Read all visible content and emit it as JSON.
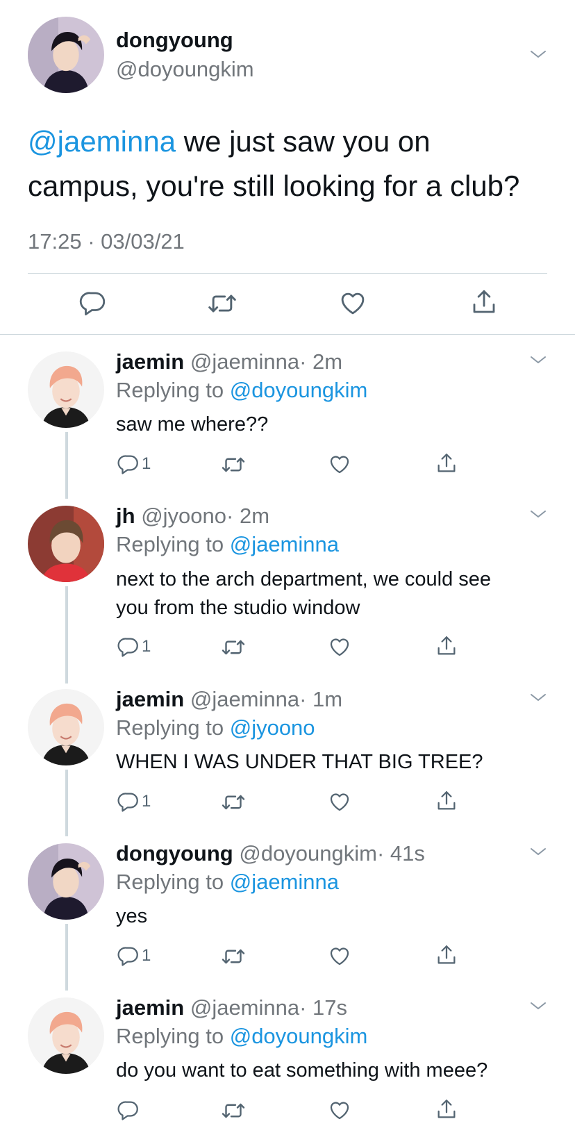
{
  "main_tweet": {
    "display_name": "dongyoung",
    "handle": "@doyoungkim",
    "mention": "@jaeminna",
    "text_line1": " we just saw you on",
    "text_line2": "campus, you're still looking for a club?",
    "timestamp": "17:25 · 03/03/21"
  },
  "replies": [
    {
      "display_name": "jaemin",
      "handle": "@jaeminna",
      "time": "· 2m",
      "replying_prefix": "Replying to ",
      "replying_to": "@doyoungkim",
      "text": "saw me where??",
      "reply_count": "1"
    },
    {
      "display_name": "jh",
      "handle": "@jyoono",
      "time": "· 2m",
      "replying_prefix": "Replying to ",
      "replying_to": "@jaeminna",
      "text_line1": "next to the arch department, we could see",
      "text_line2": "you from the studio window",
      "reply_count": "1"
    },
    {
      "display_name": "jaemin",
      "handle": "@jaeminna",
      "time": "· 1m",
      "replying_prefix": "Replying to ",
      "replying_to": "@jyoono",
      "text": "WHEN I WAS UNDER THAT BIG TREE?",
      "reply_count": "1"
    },
    {
      "display_name": "dongyoung",
      "handle": "@doyoungkim",
      "time": "· 41s",
      "replying_prefix": "Replying to ",
      "replying_to": "@jaeminna",
      "text": "yes",
      "reply_count": "1"
    },
    {
      "display_name": "jaemin",
      "handle": "@jaeminna",
      "time": "· 17s",
      "replying_prefix": "Replying to ",
      "replying_to": "@doyoungkim",
      "text": "do you want to eat something with meee?",
      "reply_count": ""
    }
  ],
  "icons": {
    "reply": "reply-icon",
    "retweet": "retweet-icon",
    "like": "like-icon",
    "share": "share-icon",
    "more": "chevron-down-icon"
  },
  "colors": {
    "link": "#1b95e0",
    "secondary_text": "#71767b",
    "divider": "#cfd9de"
  }
}
